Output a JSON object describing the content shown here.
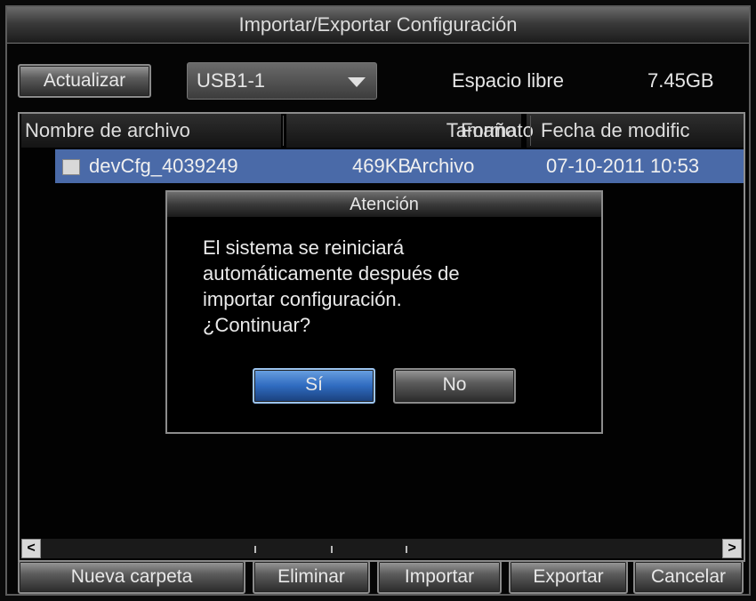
{
  "window": {
    "title": "Importar/Exportar Configuración"
  },
  "toolbar": {
    "refresh_label": "Actualizar",
    "device_value": "USB1-1",
    "free_space_label": "Espacio libre",
    "free_space_value": "7.45GB"
  },
  "file_list": {
    "columns": [
      "Nombre de archivo",
      "Tamaño",
      "Formato",
      "Fecha de modific"
    ],
    "rows": [
      {
        "name": "devCfg_4039249",
        "size": "469KB",
        "format": "Archivo",
        "date": "07-10-2011 10:53"
      }
    ]
  },
  "dialog": {
    "title": "Atención",
    "message_lines": [
      "El sistema se reiniciará",
      "automáticamente después de",
      "importar configuración.",
      "¿Continuar?"
    ],
    "yes_label": "Sí",
    "no_label": "No"
  },
  "footer": {
    "new_folder_label": "Nueva carpeta",
    "delete_label": "Eliminar",
    "import_label": "Importar",
    "export_label": "Exportar",
    "cancel_label": "Cancelar"
  },
  "scrollbar": {
    "left_arrow": "<",
    "right_arrow": ">"
  },
  "colors": {
    "selected_row": "#4a6aa8",
    "focus_button": "#2f6bc0"
  }
}
